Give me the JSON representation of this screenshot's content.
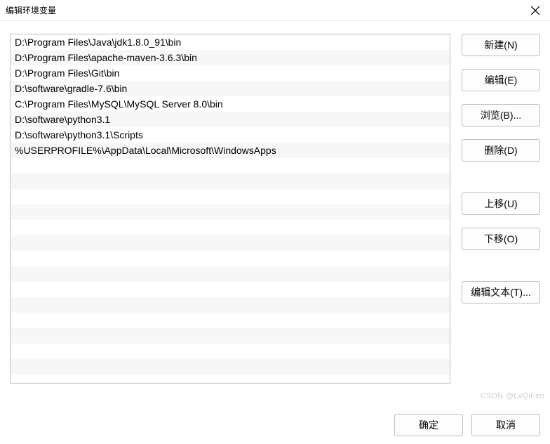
{
  "window": {
    "title": "编辑环境变量"
  },
  "pathList": {
    "items": [
      "D:\\Program Files\\Java\\jdk1.8.0_91\\bin",
      "D:\\Program Files\\apache-maven-3.6.3\\bin",
      "D:\\Program Files\\Git\\bin",
      "D:\\software\\gradle-7.6\\bin",
      "C:\\Program Files\\MySQL\\MySQL Server 8.0\\bin",
      "D:\\software\\python3.1",
      "D:\\software\\python3.1\\Scripts",
      "%USERPROFILE%\\AppData\\Local\\Microsoft\\WindowsApps"
    ]
  },
  "buttons": {
    "new": "新建(N)",
    "edit": "编辑(E)",
    "browse": "浏览(B)...",
    "delete": "删除(D)",
    "moveUp": "上移(U)",
    "moveDown": "下移(O)",
    "editText": "编辑文本(T)...",
    "ok": "确定",
    "cancel": "取消"
  },
  "watermark": "CSDN @LvQiFen"
}
